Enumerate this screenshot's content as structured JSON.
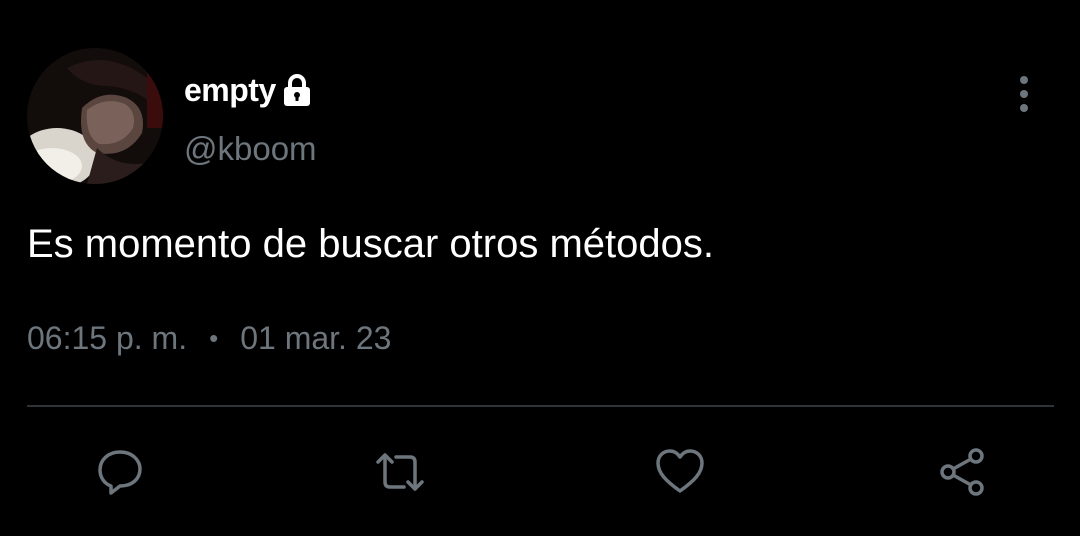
{
  "tweet": {
    "display_name": "empty",
    "handle": "@kboom",
    "text": "Es momento de buscar otros métodos.",
    "time": "06:15 p. m.",
    "separator": "•",
    "date": "01 mar. 23",
    "protected": true
  },
  "icons": {
    "lock": "lock-icon",
    "more": "more-vertical-icon",
    "reply": "reply-icon",
    "retweet": "retweet-icon",
    "like": "heart-icon",
    "share": "share-icon"
  },
  "colors": {
    "background": "#000000",
    "primary_text": "#ffffff",
    "secondary_text": "#6e767d",
    "divider": "#2f3336",
    "icon": "#6e767d"
  }
}
